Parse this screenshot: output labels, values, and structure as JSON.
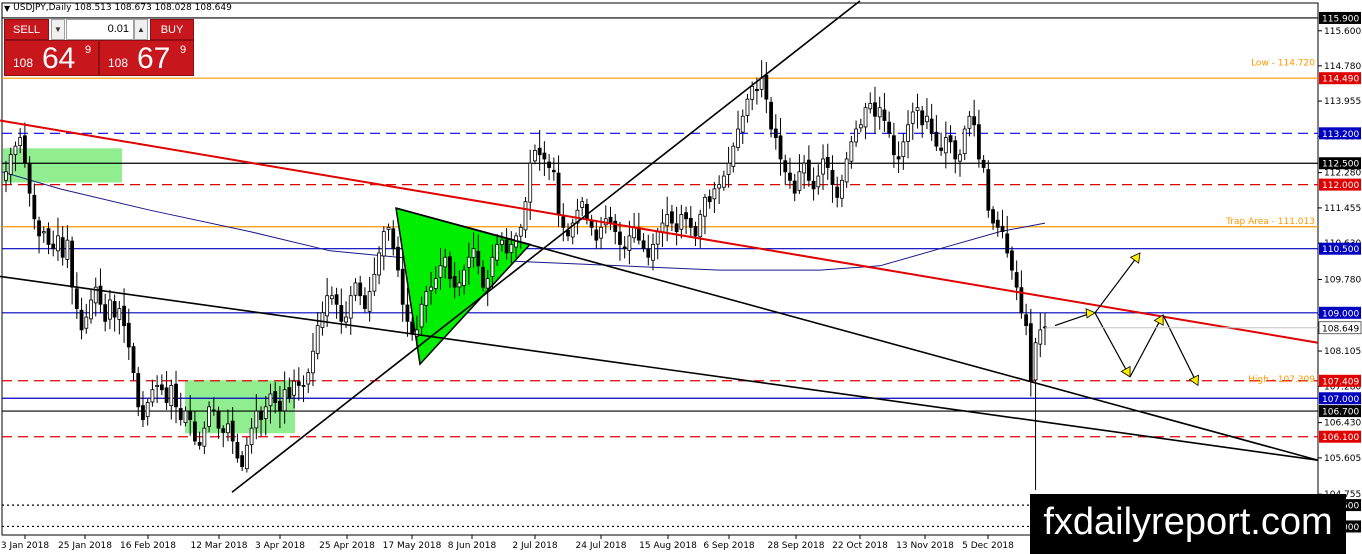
{
  "header": {
    "symbol_tf": "USDJPY,Daily",
    "ohlc": "108.513 108.673 108.028 108.649"
  },
  "trade_panel": {
    "sell_label": "SELL",
    "buy_label": "BUY",
    "lot": "0.01",
    "sell_small": "108",
    "sell_big": "64",
    "sell_sup": "9",
    "buy_small": "108",
    "buy_big": "67",
    "buy_sup": "9"
  },
  "watermark": "fxdailyreport.com",
  "colors": {
    "up_candle": "#000000",
    "down_candle": "#000000",
    "accent_red": "#e00000",
    "level_orange": "#ff9900",
    "zone_green": "#00dd00",
    "ma_blue": "#00007f"
  },
  "chart_data": {
    "type": "candlestick",
    "symbol": "USDJPY",
    "timeframe": "Daily",
    "ylim": [
      103.8,
      116.25
    ],
    "y_ticks": [
      "115.600",
      "114.780",
      "113.955",
      "113.130",
      "112.280",
      "111.455",
      "110.630",
      "109.780",
      "108.955",
      "108.105",
      "107.280",
      "106.430",
      "105.605",
      "104.755",
      "103.930"
    ],
    "x_ticks": [
      "3 Jan 2018",
      "25 Jan 2018",
      "16 Feb 2018",
      "12 Mar 2018",
      "3 Apr 2018",
      "25 Apr 2018",
      "17 May 2018",
      "8 Jun 2018",
      "2 Jul 2018",
      "24 Jul 2018",
      "15 Aug 2018",
      "6 Sep 2018",
      "28 Sep 2018",
      "22 Oct 2018",
      "13 Nov 2018",
      "5 Dec 2018"
    ],
    "levels": [
      {
        "price": 115.9,
        "label": "115.900",
        "style": "solid",
        "color": "#000000",
        "tag_bg": "#000000"
      },
      {
        "price": 114.49,
        "label": "114.490",
        "style": "solid",
        "color": "#ff9900",
        "tag_bg": "#e00000"
      },
      {
        "price": 113.2,
        "label": "113.200",
        "style": "dash",
        "color": "#0000ff",
        "tag_bg": "#0000c0"
      },
      {
        "price": 112.5,
        "label": "112.500",
        "style": "solid",
        "color": "#000000",
        "tag_bg": "#000000"
      },
      {
        "price": 112.0,
        "label": "112.000",
        "style": "dash",
        "color": "#e00000",
        "tag_bg": "#e00000"
      },
      {
        "price": 111.013,
        "label": "",
        "style": "solid",
        "color": "#ff9900",
        "tag_bg": ""
      },
      {
        "price": 110.5,
        "label": "110.500",
        "style": "solid",
        "color": "#0000c0",
        "tag_bg": "#0000c0"
      },
      {
        "price": 109.0,
        "label": "109.000",
        "style": "solid",
        "color": "#0000c0",
        "tag_bg": "#0000c0"
      },
      {
        "price": 107.409,
        "label": "107.409",
        "style": "dash",
        "color": "#e00000",
        "tag_bg": "#e00000"
      },
      {
        "price": 107.0,
        "label": "107.000",
        "style": "solid",
        "color": "#0000c0",
        "tag_bg": "#0000c0"
      },
      {
        "price": 106.7,
        "label": "106.700",
        "style": "solid",
        "color": "#000000",
        "tag_bg": "#000000"
      },
      {
        "price": 106.1,
        "label": "106.100",
        "style": "dash",
        "color": "#e00000",
        "tag_bg": "#e00000"
      },
      {
        "price": 104.5,
        "label": "104.500",
        "style": "dot",
        "color": "#000000",
        "tag_bg": "#000000"
      },
      {
        "price": 104.0,
        "label": "104.000",
        "style": "dot",
        "color": "#000000",
        "tag_bg": "#000000"
      }
    ],
    "current_price": {
      "price": 108.649,
      "label": "108.649"
    },
    "annotations": [
      {
        "text": "Low - 114.720",
        "price": 114.72
      },
      {
        "text": "Trap Area - 111.013",
        "price": 111.013
      },
      {
        "text": "High - 107.309",
        "price": 107.309
      }
    ],
    "closes": [
      112.3,
      112.7,
      112.9,
      113.1,
      112.5,
      111.8,
      111.2,
      110.8,
      110.9,
      110.6,
      110.5,
      110.8,
      110.3,
      110.7,
      109.6,
      109.1,
      108.6,
      108.9,
      109.3,
      109.6,
      109.2,
      108.8,
      109.3,
      108.9,
      109.1,
      108.7,
      108.2,
      107.6,
      106.8,
      106.5,
      106.9,
      107.2,
      107.3,
      107.2,
      106.9,
      107.3,
      106.8,
      106.5,
      106.7,
      106.5,
      106.0,
      105.9,
      106.3,
      106.8,
      106.7,
      106.3,
      106.2,
      106.4,
      106.0,
      105.6,
      105.4,
      105.9,
      106.3,
      106.7,
      106.5,
      106.8,
      107.1,
      106.9,
      106.7,
      107.2,
      107.0,
      107.4,
      107.3,
      107.3,
      107.6,
      108.1,
      108.7,
      109.0,
      109.4,
      109.4,
      109.2,
      108.8,
      108.9,
      109.4,
      109.7,
      109.4,
      109.1,
      109.5,
      109.9,
      110.4,
      110.9,
      111.0,
      110.5,
      110.0,
      109.2,
      108.8,
      108.5,
      108.6,
      109.2,
      109.5,
      109.6,
      109.8,
      110.1,
      110.3,
      109.8,
      109.6,
      109.7,
      110.0,
      110.3,
      110.5,
      110.1,
      109.6,
      109.8,
      110.3,
      110.6,
      110.7,
      110.4,
      110.6,
      110.8,
      111.0,
      111.6,
      112.5,
      112.8,
      112.7,
      112.6,
      112.4,
      112.3,
      111.3,
      111.0,
      110.8,
      111.1,
      111.4,
      111.6,
      111.2,
      111.0,
      110.7,
      111.0,
      111.2,
      111.1,
      110.9,
      110.6,
      110.5,
      110.8,
      111.0,
      110.7,
      110.5,
      110.3,
      110.6,
      110.9,
      111.1,
      111.3,
      111.1,
      110.9,
      111.3,
      111.2,
      111.0,
      110.8,
      111.3,
      111.7,
      111.6,
      111.9,
      112.0,
      112.2,
      112.5,
      112.9,
      113.3,
      113.6,
      114.0,
      114.3,
      114.2,
      114.5,
      114.0,
      113.3,
      113.1,
      112.6,
      112.3,
      112.1,
      111.8,
      112.3,
      112.5,
      112.1,
      111.9,
      112.2,
      112.6,
      112.4,
      112.0,
      111.7,
      112.1,
      112.6,
      113.0,
      113.3,
      113.4,
      113.8,
      113.9,
      113.6,
      113.8,
      113.5,
      113.2,
      112.7,
      112.6,
      113.0,
      113.4,
      113.7,
      113.8,
      113.4,
      113.6,
      113.2,
      112.9,
      112.8,
      113.1,
      113.0,
      112.6,
      112.7,
      113.3,
      113.6,
      113.4,
      112.6,
      112.4,
      111.4,
      111.1,
      111.0,
      110.9,
      110.4,
      110.0,
      109.6,
      109.0,
      108.7,
      107.4,
      108.3,
      108.6,
      108.649
    ],
    "trendlines": [
      {
        "name": "red",
        "color": "#e00000",
        "x1": 0,
        "p1": 113.5,
        "x2": 1318,
        "p2": 108.3
      },
      {
        "name": "black_lower",
        "color": "#000000",
        "x1": 0,
        "p1": 109.85,
        "x2": 1318,
        "p2": 105.55
      },
      {
        "name": "black_rising",
        "color": "#000000",
        "x1": 232,
        "p1": 104.8,
        "x2": 860,
        "p2": 116.3
      },
      {
        "name": "black_falling",
        "color": "#000000",
        "x1": 396,
        "p1": 111.45,
        "x2": 1318,
        "p2": 105.55
      }
    ]
  }
}
